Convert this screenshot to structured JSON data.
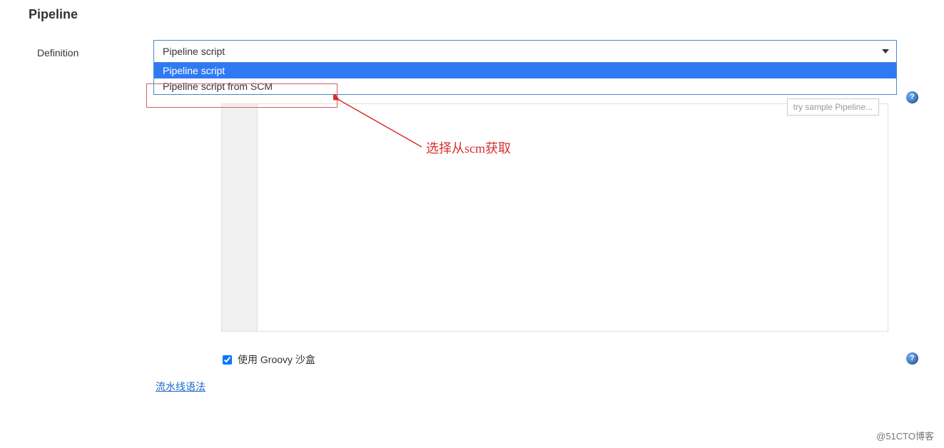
{
  "section": {
    "title": "Pipeline",
    "definition_label": "Definition"
  },
  "dropdown": {
    "selected": "Pipeline script",
    "options": [
      {
        "label": "Pipeline script",
        "highlighted": true
      },
      {
        "label": "Pipeline script from SCM",
        "highlighted": false
      }
    ]
  },
  "sample_label": "try sample Pipeline...",
  "sandbox": {
    "label": "使用 Groovy 沙盒",
    "checked": true
  },
  "syntax_link": "流水线语法",
  "annotation": {
    "text": "选择从scm获取"
  },
  "help_glyph": "?",
  "watermark": "@51CTO博客"
}
